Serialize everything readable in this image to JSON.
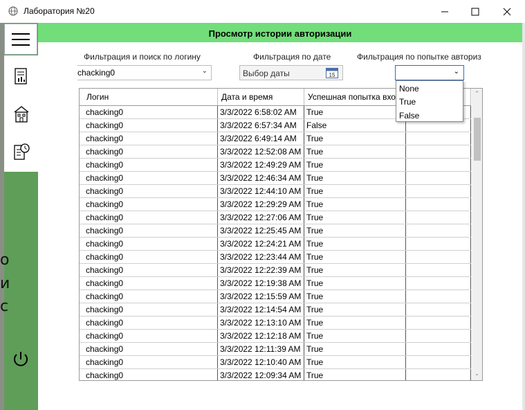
{
  "window": {
    "title": "Лаборатория №20",
    "app_icon": "globe-icon",
    "controls": [
      "minimize-icon",
      "maximize-icon",
      "close-icon"
    ]
  },
  "sidebar": {
    "menu_icon": "hamburger-icon",
    "items": [
      {
        "icon": "report-icon"
      },
      {
        "icon": "building-icon"
      },
      {
        "icon": "history-icon"
      }
    ],
    "power_icon": "power-icon",
    "background_text": [
      "о",
      "и",
      "с"
    ]
  },
  "header": {
    "title": "Просмотр истории авторизации",
    "color": "#71de7a"
  },
  "filters": {
    "login_label": "Фильтрация и поиск по логину",
    "login_value": "chacking0",
    "date_label": "Фильтрация по дате",
    "date_placeholder": "Выбор даты",
    "attempt_label": "Фильтрация по попытке авториз",
    "attempt_value": "",
    "attempt_options": [
      "None",
      "True",
      "False"
    ]
  },
  "table": {
    "columns": [
      "Логин",
      "Дата и время",
      "Успешная попытка вхо",
      ""
    ],
    "rows": [
      {
        "login": "chacking0",
        "datetime": "3/3/2022 6:58:02 AM",
        "success": "True"
      },
      {
        "login": "chacking0",
        "datetime": "3/3/2022 6:57:34 AM",
        "success": "False"
      },
      {
        "login": "chacking0",
        "datetime": "3/3/2022 6:49:14 AM",
        "success": "True"
      },
      {
        "login": "chacking0",
        "datetime": "3/3/2022 12:52:08 AM",
        "success": "True"
      },
      {
        "login": "chacking0",
        "datetime": "3/3/2022 12:49:29 AM",
        "success": "True"
      },
      {
        "login": "chacking0",
        "datetime": "3/3/2022 12:46:34 AM",
        "success": "True"
      },
      {
        "login": "chacking0",
        "datetime": "3/3/2022 12:44:10 AM",
        "success": "True"
      },
      {
        "login": "chacking0",
        "datetime": "3/3/2022 12:29:29 AM",
        "success": "True"
      },
      {
        "login": "chacking0",
        "datetime": "3/3/2022 12:27:06 AM",
        "success": "True"
      },
      {
        "login": "chacking0",
        "datetime": "3/3/2022 12:25:45 AM",
        "success": "True"
      },
      {
        "login": "chacking0",
        "datetime": "3/3/2022 12:24:21 AM",
        "success": "True"
      },
      {
        "login": "chacking0",
        "datetime": "3/3/2022 12:23:44 AM",
        "success": "True"
      },
      {
        "login": "chacking0",
        "datetime": "3/3/2022 12:22:39 AM",
        "success": "True"
      },
      {
        "login": "chacking0",
        "datetime": "3/3/2022 12:19:38 AM",
        "success": "True"
      },
      {
        "login": "chacking0",
        "datetime": "3/3/2022 12:15:59 AM",
        "success": "True"
      },
      {
        "login": "chacking0",
        "datetime": "3/3/2022 12:14:54 AM",
        "success": "True"
      },
      {
        "login": "chacking0",
        "datetime": "3/3/2022 12:13:10 AM",
        "success": "True"
      },
      {
        "login": "chacking0",
        "datetime": "3/3/2022 12:12:18 AM",
        "success": "True"
      },
      {
        "login": "chacking0",
        "datetime": "3/3/2022 12:11:39 AM",
        "success": "True"
      },
      {
        "login": "chacking0",
        "datetime": "3/3/2022 12:10:40 AM",
        "success": "True"
      },
      {
        "login": "chacking0",
        "datetime": "3/3/2022 12:09:34 AM",
        "success": "True"
      }
    ]
  },
  "colors": {
    "sidebar": "#5e9e58",
    "accent_border": "#2a6ad4"
  }
}
